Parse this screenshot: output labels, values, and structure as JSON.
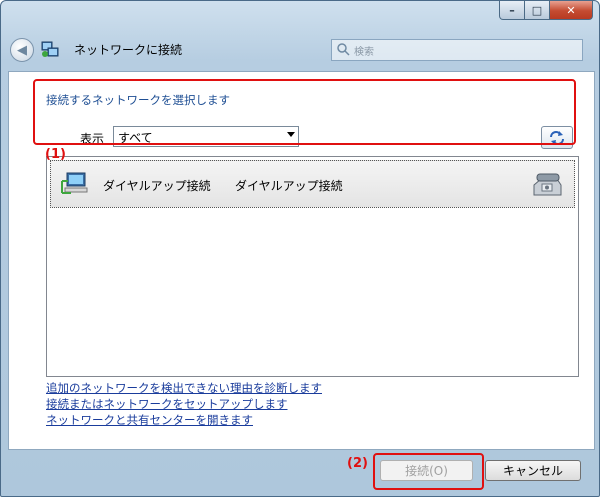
{
  "window": {
    "title": "ネットワークに接続",
    "search_placeholder": "検索",
    "controls": {
      "minimize": "–",
      "maximize": "□",
      "close": "✕"
    }
  },
  "main": {
    "heading": "接続するネットワークを選択します",
    "filter": {
      "label": "表示",
      "selected": "すべて"
    },
    "networks": [
      {
        "name": "ダイヤルアップ接続",
        "type": "ダイヤルアップ接続",
        "icon": "dialup-network-icon",
        "status_icon": "telephone-icon"
      }
    ],
    "links": [
      "追加のネットワークを検出できない理由を診断します",
      "接続またはネットワークをセットアップします",
      "ネットワークと共有センターを開きます"
    ]
  },
  "annotations": {
    "one": "(1)",
    "two": "(2)",
    "color": "#e01010"
  },
  "footer": {
    "connect_label": "接続(O)",
    "cancel_label": "キャンセル"
  },
  "colors": {
    "link": "#1a3c9c",
    "heading": "#1f4f94",
    "chrome": "#b6cde1"
  }
}
